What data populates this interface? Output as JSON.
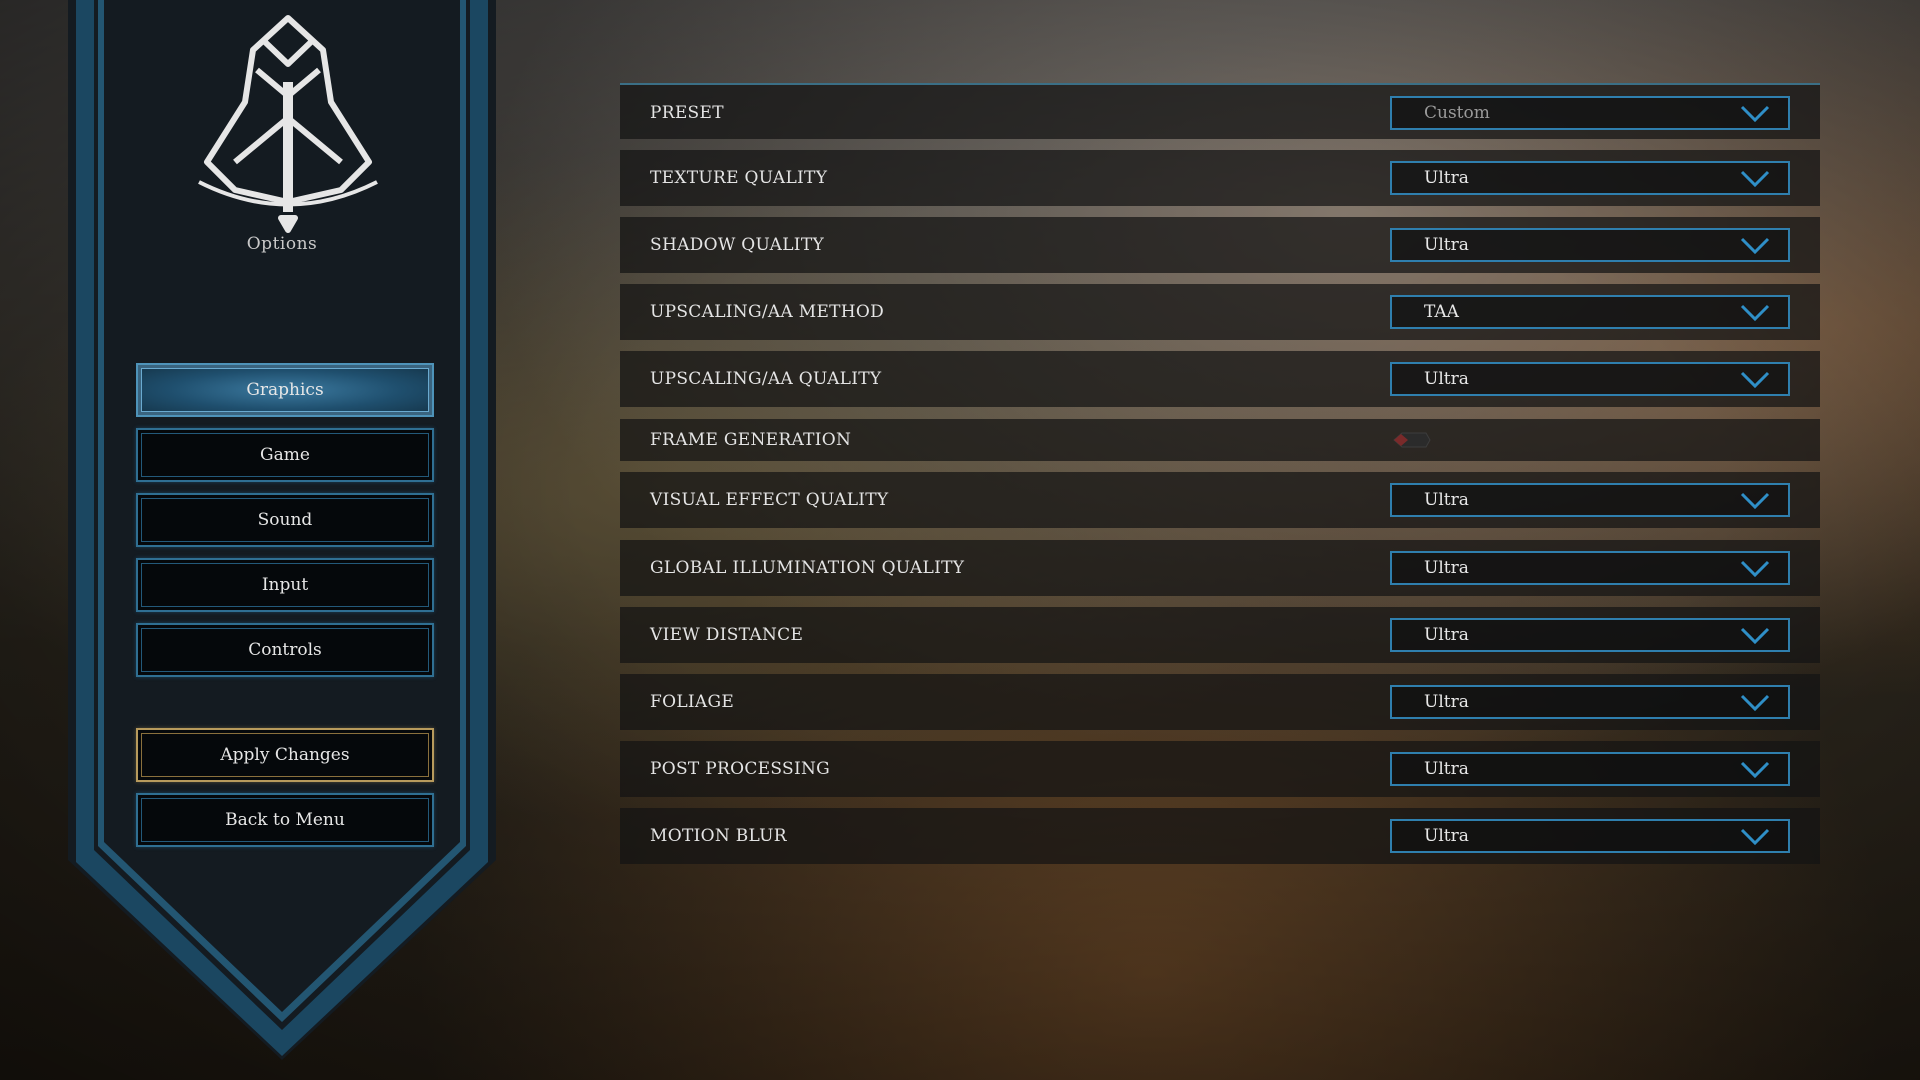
{
  "sidebar": {
    "title": "Options",
    "nav": [
      {
        "label": "Graphics",
        "active": true
      },
      {
        "label": "Game",
        "active": false
      },
      {
        "label": "Sound",
        "active": false
      },
      {
        "label": "Input",
        "active": false
      },
      {
        "label": "Controls",
        "active": false
      }
    ],
    "apply_label": "Apply Changes",
    "back_label": "Back to Menu"
  },
  "settings": [
    {
      "label": "PRESET",
      "value": "Custom",
      "type": "dropdown"
    },
    {
      "label": "TEXTURE QUALITY",
      "value": "Ultra",
      "type": "dropdown"
    },
    {
      "label": "SHADOW QUALITY",
      "value": "Ultra",
      "type": "dropdown"
    },
    {
      "label": "UPSCALING/AA METHOD",
      "value": "TAA",
      "type": "dropdown"
    },
    {
      "label": "UPSCALING/AA QUALITY",
      "value": "Ultra",
      "type": "dropdown"
    },
    {
      "label": "FRAME GENERATION",
      "value": "",
      "type": "toggle",
      "enabled": false
    },
    {
      "label": "VISUAL EFFECT QUALITY",
      "value": "Ultra",
      "type": "dropdown"
    },
    {
      "label": "GLOBAL ILLUMINATION QUALITY",
      "value": "Ultra",
      "type": "dropdown"
    },
    {
      "label": "VIEW DISTANCE",
      "value": "Ultra",
      "type": "dropdown"
    },
    {
      "label": "FOLIAGE",
      "value": "Ultra",
      "type": "dropdown"
    },
    {
      "label": "POST PROCESSING",
      "value": "Ultra",
      "type": "dropdown"
    },
    {
      "label": "MOTION BLUR",
      "value": "Ultra",
      "type": "dropdown"
    }
  ],
  "icons": {
    "emblem": "bell-knot-emblem-icon",
    "dropdown": "chevron-down-icon",
    "toggle": "toggle-off-icon"
  },
  "colors": {
    "accent_blue": "#2f7fae",
    "banner_dark": "#151d24",
    "gold": "#b79a5c",
    "toggle_off": "#7a2a2a"
  }
}
